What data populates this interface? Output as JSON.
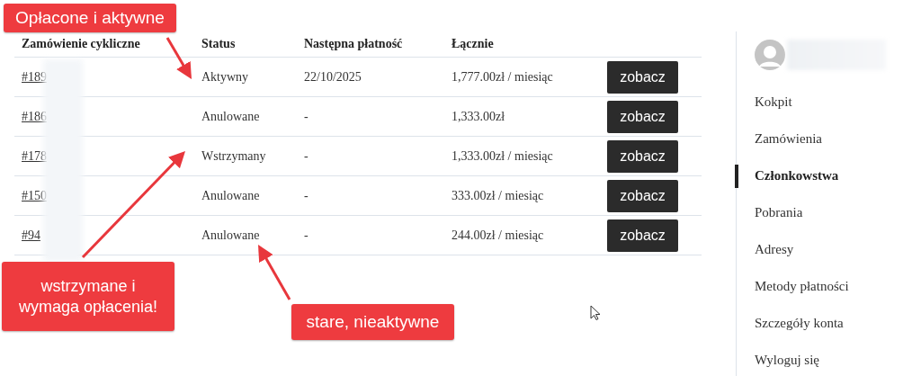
{
  "table": {
    "columns": [
      "Zamówienie cykliczne",
      "Status",
      "Następna płatność",
      "Łącznie"
    ],
    "rows": [
      {
        "order": "#189",
        "status": "Aktywny",
        "next_payment": "22/10/2025",
        "total": "1,777.00zł / miesiąc",
        "action": "zobacz"
      },
      {
        "order": "#186",
        "status": "Anulowane",
        "next_payment": "-",
        "total": "1,333.00zł",
        "action": "zobacz"
      },
      {
        "order": "#178",
        "status": "Wstrzymany",
        "next_payment": "-",
        "total": "1,333.00zł / miesiąc",
        "action": "zobacz"
      },
      {
        "order": "#150",
        "status": "Anulowane",
        "next_payment": "-",
        "total": "333.00zł / miesiąc",
        "action": "zobacz"
      },
      {
        "order": "#94",
        "status": "Anulowane",
        "next_payment": "-",
        "total": "244.00zł / miesiąc",
        "action": "zobacz"
      }
    ]
  },
  "sidebar": {
    "items": [
      {
        "label": "Kokpit",
        "selected": false
      },
      {
        "label": "Zamówienia",
        "selected": false
      },
      {
        "label": "Członkowstwa",
        "selected": true
      },
      {
        "label": "Pobrania",
        "selected": false
      },
      {
        "label": "Adresy",
        "selected": false
      },
      {
        "label": "Metody płatności",
        "selected": false
      },
      {
        "label": "Szczegóły konta",
        "selected": false
      },
      {
        "label": "Wyloguj się",
        "selected": false
      }
    ]
  },
  "annotations": [
    {
      "text": "Opłacone i aktywne"
    },
    {
      "text": "wstrzymane i wymaga opłacenia!"
    },
    {
      "text": "stare, nieaktywne"
    }
  ]
}
